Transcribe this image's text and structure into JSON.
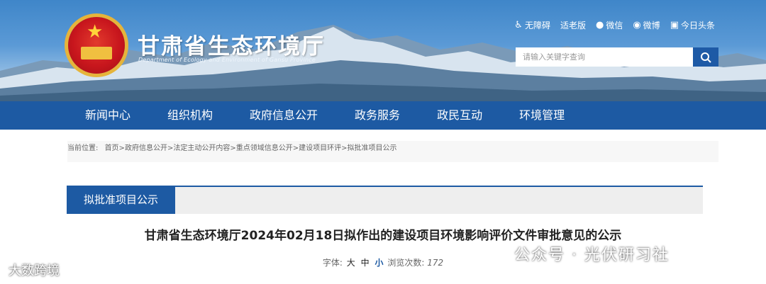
{
  "header": {
    "title": "甘肃省生态环境厅",
    "subtitle": "Department of Ecology and Environment of Gansu Province",
    "links": [
      {
        "label": "无障碍",
        "icon": "accessibility-icon"
      },
      {
        "label": "适老版",
        "icon": ""
      },
      {
        "label": "微信",
        "icon": "wechat-icon"
      },
      {
        "label": "微博",
        "icon": "weibo-icon"
      },
      {
        "label": "今日头条",
        "icon": "toutiao-icon"
      }
    ],
    "search": {
      "placeholder": "请输入关键字查询"
    }
  },
  "nav": {
    "items": [
      "新闻中心",
      "组织机构",
      "政府信息公开",
      "政务服务",
      "政民互动",
      "环境管理"
    ]
  },
  "breadcrumb": {
    "prefix": "当前位置:",
    "path": "首页>政府信息公开>法定主动公开内容>重点领域信息公开>建设项目环评>拟批准项目公示"
  },
  "section": {
    "tab_label": "拟批准项目公示"
  },
  "article": {
    "title": "甘肃省生态环境厅2024年02月18日拟作出的建设项目环境影响评价文件审批意见的公示",
    "font_label": "字体:",
    "sizes": [
      "大",
      "中",
      "小"
    ],
    "views_label": "浏览次数:",
    "views": "172"
  },
  "watermarks": {
    "right": "公众号 · 光伏研习社",
    "left": "大数跨境"
  },
  "colors": {
    "nav_bg": "#1d5aa3",
    "accent": "#1d5aa3"
  }
}
